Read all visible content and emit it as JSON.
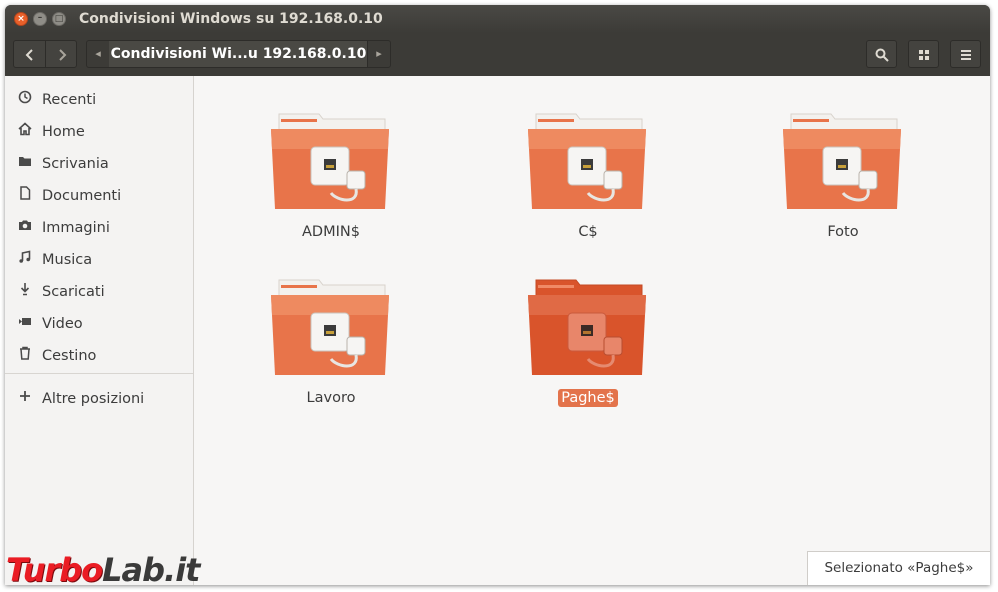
{
  "window": {
    "title": "Condivisioni Windows su 192.168.0.10"
  },
  "toolbar": {
    "back_icon": "chevron-left-icon",
    "forward_icon": "chevron-right-icon",
    "path_label": "Condivisioni Wi...u 192.168.0.10",
    "search_icon": "search-icon",
    "view_icon": "grid-view-icon",
    "menu_icon": "hamburger-menu-icon"
  },
  "sidebar": {
    "items": [
      {
        "label": "Recenti",
        "icon": "clock-icon"
      },
      {
        "label": "Home",
        "icon": "home-icon"
      },
      {
        "label": "Scrivania",
        "icon": "folder-icon"
      },
      {
        "label": "Documenti",
        "icon": "document-icon"
      },
      {
        "label": "Immagini",
        "icon": "camera-icon"
      },
      {
        "label": "Musica",
        "icon": "music-note-icon"
      },
      {
        "label": "Scaricati",
        "icon": "download-icon"
      },
      {
        "label": "Video",
        "icon": "video-camera-icon"
      },
      {
        "label": "Cestino",
        "icon": "trash-icon"
      }
    ],
    "other_locations": {
      "label": "Altre posizioni",
      "icon": "plus-icon"
    }
  },
  "content": {
    "items": [
      {
        "name": "ADMIN$",
        "selected": false
      },
      {
        "name": "C$",
        "selected": false
      },
      {
        "name": "Foto",
        "selected": false
      },
      {
        "name": "Lavoro",
        "selected": false
      },
      {
        "name": "Paghe$",
        "selected": true
      }
    ]
  },
  "status": {
    "text": "Selezionato «Paghe$»"
  },
  "watermark": {
    "part1": "Turbo",
    "part2": "Lab.it"
  },
  "colors": {
    "accent": "#e3734b",
    "folder": "#e8744a",
    "folder_selected": "#d9542b"
  }
}
